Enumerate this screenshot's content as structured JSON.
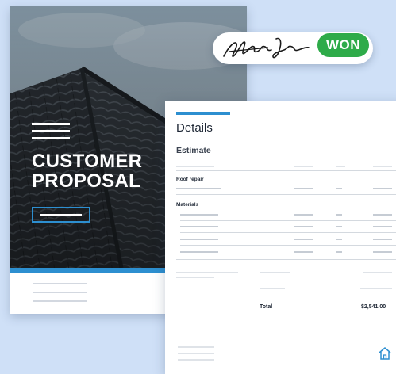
{
  "cover": {
    "title_line1": "CUSTOMER",
    "title_line2": "PROPOSAL"
  },
  "badge": {
    "label": "WON",
    "color": "#2eab49"
  },
  "signature": {
    "icon": "handwritten-signature"
  },
  "details": {
    "title": "Details",
    "subtitle": "Estimate",
    "sections": [
      "Roof repair",
      "Materials"
    ],
    "total_label": "Total",
    "total_value": "$2,541.00"
  },
  "icons": {
    "footer": "house-icon"
  },
  "colors": {
    "background": "#cfe0f7",
    "accent": "#2d8fd0",
    "won": "#2eab49"
  }
}
